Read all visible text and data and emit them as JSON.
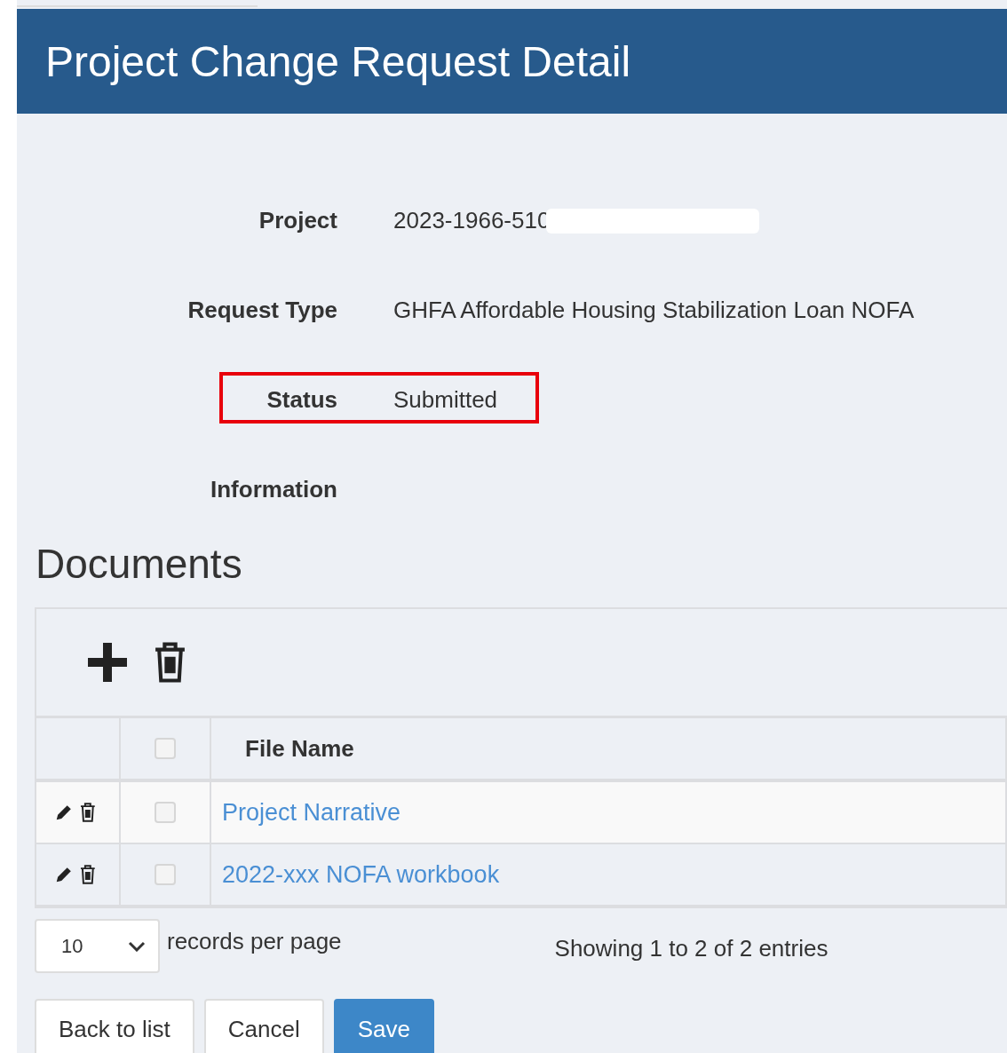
{
  "header": {
    "title": "Project Change Request Detail"
  },
  "fields": [
    {
      "label": "Project",
      "value": "2023-1966-510",
      "redacted": true,
      "highlighted": false
    },
    {
      "label": "Request Type",
      "value": "GHFA Affordable Housing Stabilization Loan NOFA",
      "redacted": false,
      "highlighted": false
    },
    {
      "label": "Status",
      "value": "Submitted",
      "redacted": false,
      "highlighted": true
    },
    {
      "label": "Information",
      "redacted": false,
      "highlighted": false
    }
  ],
  "documents": {
    "title": "Documents",
    "table": {
      "columns": [
        "File Name"
      ],
      "select_all": {
        "checked": false
      },
      "rows": [
        {
          "file_name": "Project Narrative",
          "checked": false
        },
        {
          "file_name": "2022-xxx NOFA workbook",
          "checked": false
        }
      ]
    },
    "page_size": "10",
    "page_size_label": "records per page",
    "summary": "Showing 1 to 2 of 2 entries"
  },
  "buttons": [
    {
      "label": "Back to list",
      "kind": "default"
    },
    {
      "label": "Cancel",
      "kind": "default"
    },
    {
      "label": "Save",
      "kind": "primary"
    }
  ]
}
